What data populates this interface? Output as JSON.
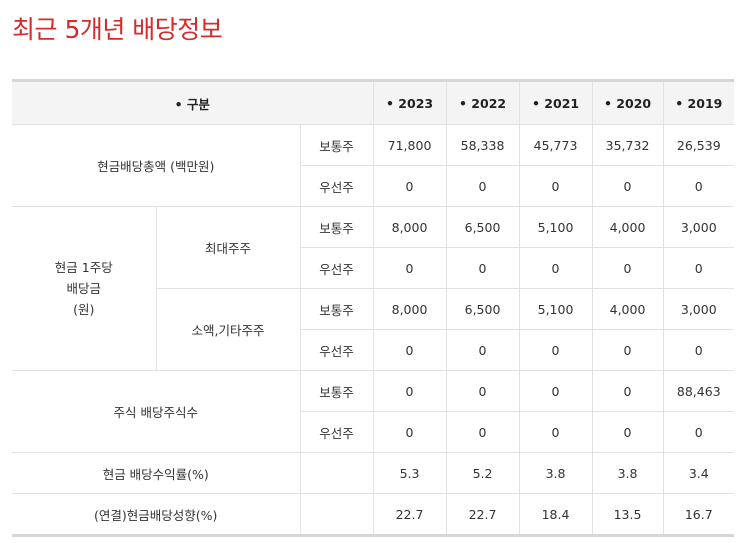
{
  "title": "최근 5개년 배당정보",
  "header": {
    "category": "• 구분",
    "years": [
      "• 2023",
      "• 2022",
      "• 2021",
      "• 2020",
      "• 2019"
    ]
  },
  "labels": {
    "total_dividend": "현금배당총액 (백만원)",
    "per_share": [
      "현금 1주당",
      "배당금",
      "(원)"
    ],
    "largest_shareholder": "최대주주",
    "minority_shareholder": "소액,기타주주",
    "stock_dividend": "주식 배당주식수",
    "yield": "현금 배당수익률(%)",
    "payout": "(연결)현금배당성향(%)",
    "common": "보통주",
    "preferred": "우선주"
  },
  "rows": {
    "total_common": [
      "71,800",
      "58,338",
      "45,773",
      "35,732",
      "26,539"
    ],
    "total_pref": [
      "0",
      "0",
      "0",
      "0",
      "0"
    ],
    "largest_common": [
      "8,000",
      "6,500",
      "5,100",
      "4,000",
      "3,000"
    ],
    "largest_pref": [
      "0",
      "0",
      "0",
      "0",
      "0"
    ],
    "minority_common": [
      "8,000",
      "6,500",
      "5,100",
      "4,000",
      "3,000"
    ],
    "minority_pref": [
      "0",
      "0",
      "0",
      "0",
      "0"
    ],
    "stock_common": [
      "0",
      "0",
      "0",
      "0",
      "88,463"
    ],
    "stock_pref": [
      "0",
      "0",
      "0",
      "0",
      "0"
    ],
    "yield": [
      "5.3",
      "5.2",
      "3.8",
      "3.8",
      "3.4"
    ],
    "payout": [
      "22.7",
      "22.7",
      "18.4",
      "13.5",
      "16.7"
    ]
  }
}
